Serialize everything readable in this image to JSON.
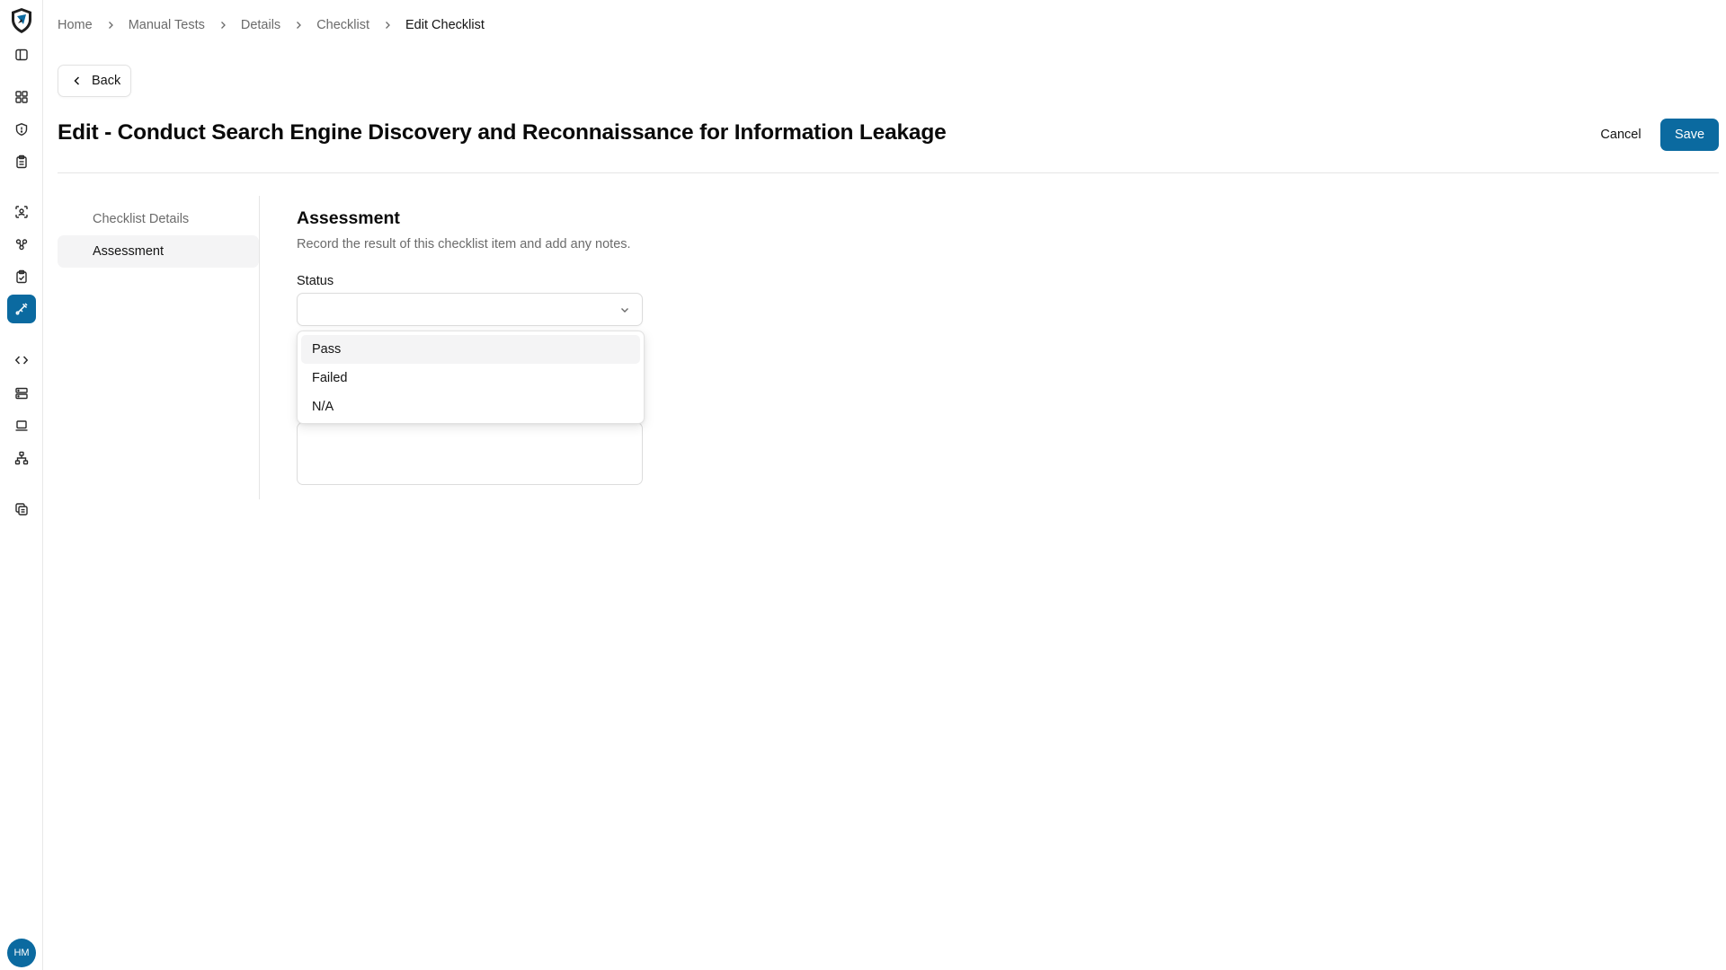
{
  "rail": {
    "logo": "shield-logo",
    "items": [
      {
        "name": "sidebar-toggle-icon",
        "active": false
      },
      {
        "name": "dashboard-icon",
        "active": false
      },
      {
        "name": "shield-icon",
        "active": false
      },
      {
        "name": "clipboard-icon",
        "active": false
      },
      {
        "name": "scan-icon",
        "active": false
      },
      {
        "name": "groups-icon",
        "active": false
      },
      {
        "name": "clipboard-check-icon",
        "active": false
      },
      {
        "name": "manual-tests-icon",
        "active": true
      },
      {
        "name": "code-icon",
        "active": false
      },
      {
        "name": "server-icon",
        "active": false
      },
      {
        "name": "laptop-icon",
        "active": false
      },
      {
        "name": "network-icon",
        "active": false
      },
      {
        "name": "copy-icon",
        "active": false
      }
    ],
    "avatar_initials": "HM"
  },
  "breadcrumb": {
    "items": [
      "Home",
      "Manual Tests",
      "Details",
      "Checklist"
    ],
    "current": "Edit Checklist"
  },
  "back_label": "Back",
  "page_title": "Edit - Conduct Search Engine Discovery and Reconnaissance for Information Leakage",
  "actions": {
    "cancel": "Cancel",
    "save": "Save"
  },
  "subnav": {
    "items": [
      {
        "label": "Checklist Details",
        "active": false
      },
      {
        "label": "Assessment",
        "active": true
      }
    ]
  },
  "assessment": {
    "title": "Assessment",
    "description": "Record the result of this checklist item and add any notes.",
    "status_label": "Status",
    "status_value": "",
    "status_options": [
      "Pass",
      "Failed",
      "N/A"
    ],
    "highlighted_option": "Pass"
  },
  "colors": {
    "accent": "#0b6aa0",
    "muted_text": "#6b6b6b",
    "border": "#e5e5e5"
  }
}
